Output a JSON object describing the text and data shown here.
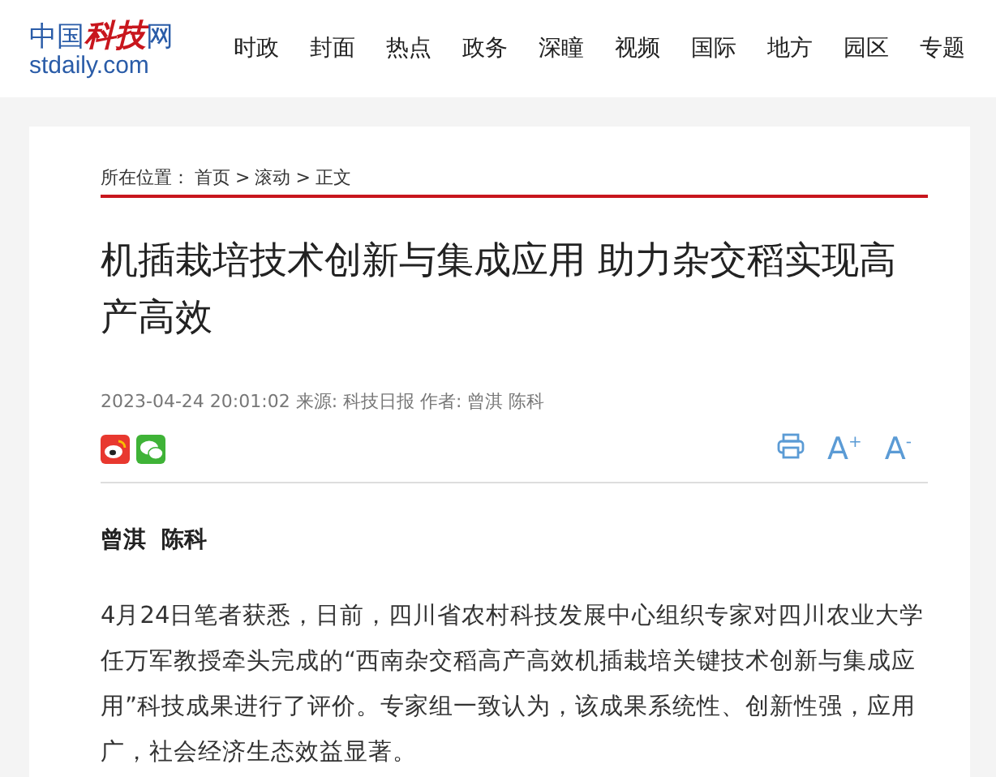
{
  "logo": {
    "prefix": "中国",
    "brand": "科技",
    "suffix": "网",
    "domain": "stdaily.com"
  },
  "nav": [
    "时政",
    "封面",
    "热点",
    "政务",
    "深瞳",
    "视频",
    "国际",
    "地方",
    "园区",
    "专题"
  ],
  "breadcrumb": {
    "label": "所在位置：",
    "items": [
      "首页",
      "滚动",
      "正文"
    ],
    "separator": ">"
  },
  "article": {
    "title": "机插栽培技术创新与集成应用 助力杂交稻实现高产高效",
    "meta": "2023-04-24 20:01:02 来源: 科技日报 作者: 曾淇 陈科",
    "share": [
      {
        "kind": "weibo"
      },
      {
        "kind": "wechat"
      }
    ],
    "tools": [
      {
        "kind": "print"
      },
      {
        "kind": "font",
        "label": "A$^{+}$"
      },
      {
        "kind": "font",
        "label": "A$^{-}$"
      }
    ],
    "author": "曾淇  陈科",
    "paragraphs": [
      "4月24日笔者获悉，日前，四川省农村科技发展中心组织专家对四川农业大学任万军教授牵头完成的“西南杂交稻高产高效机插栽培关键技术创新与集成应用”科技成果进行了评价。专家组一致认为，该成果系统性、创新性强，应用广，社会经济生态效益显著。"
    ]
  }
}
